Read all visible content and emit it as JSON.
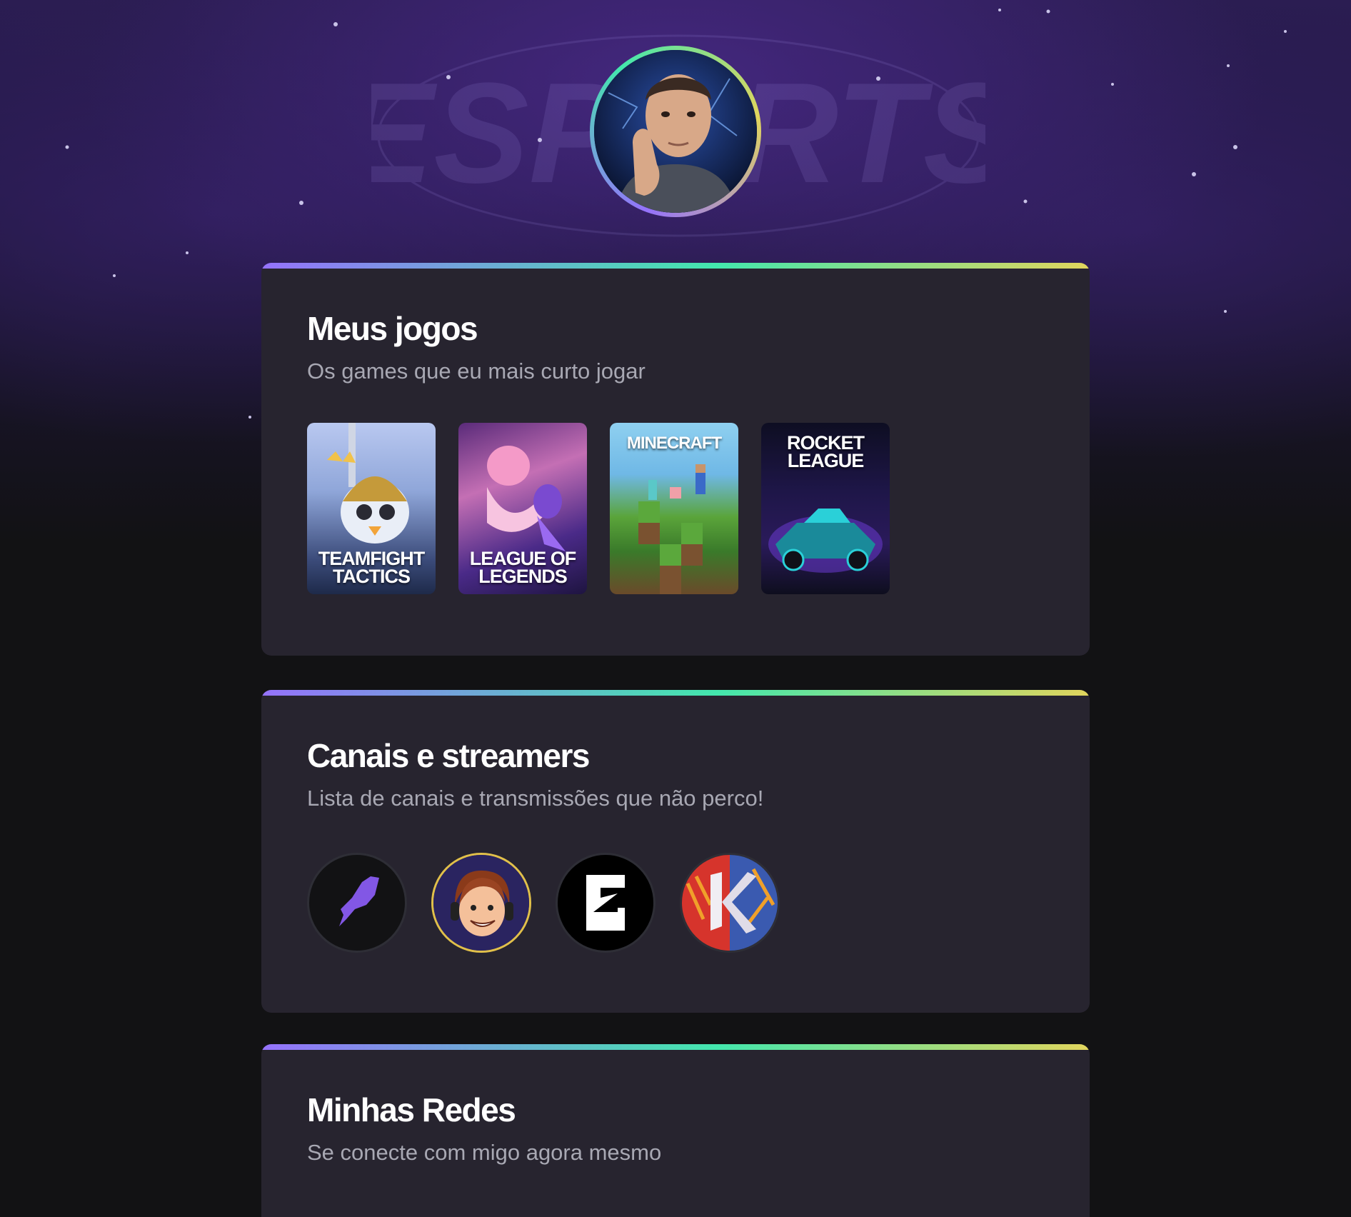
{
  "profile": {
    "avatar_icon": "profile-photo",
    "ring_colors": [
      "#9572fc",
      "#43e7ad",
      "#e1d55d"
    ],
    "watermark": "ESPORTS"
  },
  "games_section": {
    "title": "Meus jogos",
    "subtitle": "Os games que eu mais curto jogar",
    "games": [
      {
        "label": "TEAMFIGHT TACTICS",
        "icon": "teamfight-tactics-cover"
      },
      {
        "label": "LEAGUE OF LEGENDS",
        "icon": "league-of-legends-cover"
      },
      {
        "label": "MINECRAFT",
        "icon": "minecraft-cover"
      },
      {
        "label": "ROCKET LEAGUE",
        "icon": "rocket-league-cover"
      }
    ]
  },
  "channels_section": {
    "title": "Canais e streamers",
    "subtitle": "Lista de canais e transmissões que não perco!",
    "channels": [
      {
        "icon": "rocketseat-icon"
      },
      {
        "icon": "streamer-cartoon-avatar"
      },
      {
        "icon": "gaules-channel-icon"
      },
      {
        "icon": "red-blue-k-channel-icon"
      }
    ]
  },
  "social_section": {
    "title": "Minhas Redes",
    "subtitle": "Se conecte com migo agora mesmo"
  },
  "colors": {
    "background": "#121214",
    "card": "#27242f",
    "title": "#ffffff",
    "subtitle": "#a8a8b3",
    "gradient": [
      "#9572fc",
      "#43e7ad",
      "#e1d55d"
    ]
  }
}
